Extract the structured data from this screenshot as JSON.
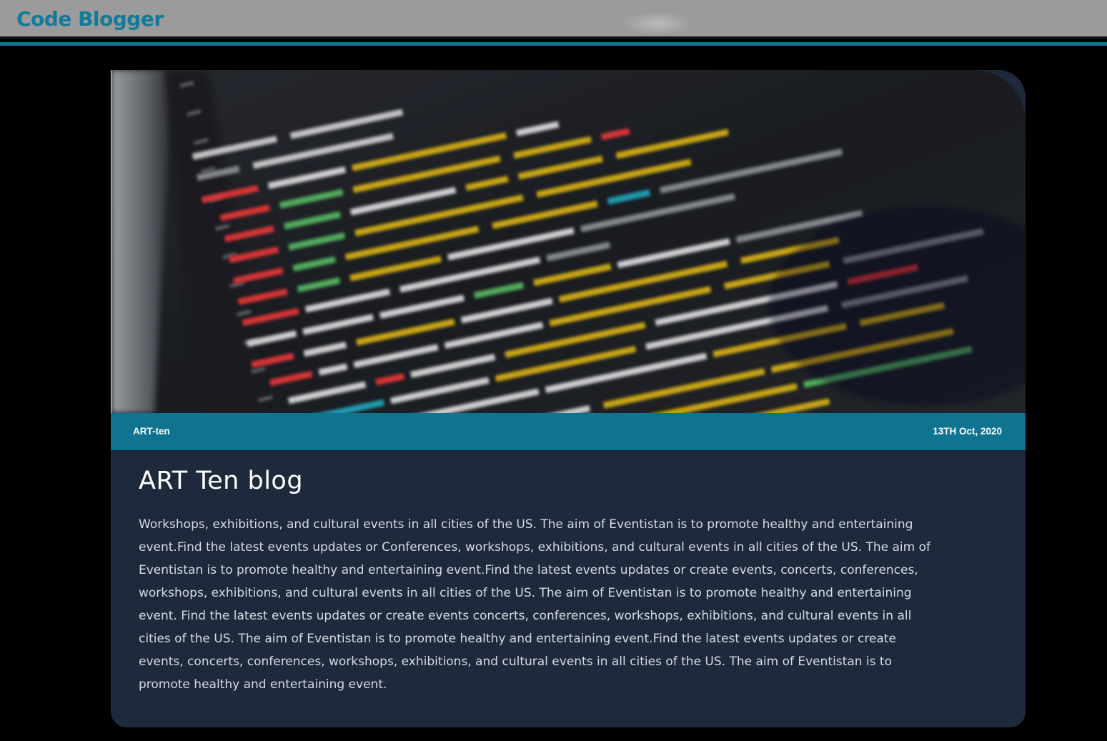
{
  "header": {
    "brand": "Code Blogger"
  },
  "post": {
    "hero_icon": "code-screenshot-image",
    "tag": "ART-ten",
    "date": "13TH Oct, 2020",
    "title": "ART Ten blog",
    "body": "Workshops, exhibitions, and cultural events in all cities of the US. The aim of Eventistan is to promote healthy and entertaining event.Find the latest events updates or Conferences, workshops, exhibitions, and cultural events in all cities of the US. The aim of Eventistan is to promote healthy and entertaining event.Find the latest events updates or create events, concerts, conferences, workshops, exhibitions, and cultural events in all cities of the US. The aim of Eventistan is to promote healthy and entertaining event. Find the latest events updates or create events concerts, conferences, workshops, exhibitions, and cultural events in all cities of the US. The aim of Eventistan is to promote healthy and entertaining event.Find the latest events updates or create events, concerts, conferences, workshops, exhibitions, and cultural events in all cities of the US. The aim of Eventistan is to promote healthy and entertaining event."
  },
  "colors": {
    "header_bg": "#9b9b9b",
    "brand": "#147a97",
    "accent": "#0f7490",
    "card_bg": "#1e293b",
    "page_bg": "#000000"
  }
}
